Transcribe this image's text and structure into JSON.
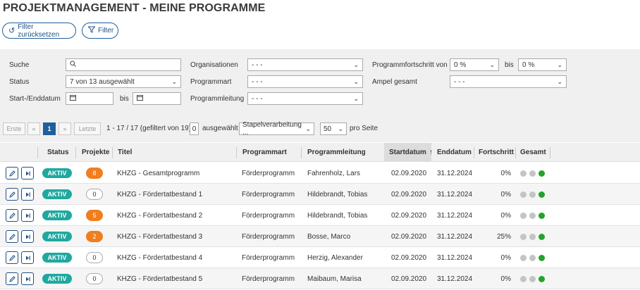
{
  "page": {
    "title": "PROJEKTMANAGEMENT - MEINE PROGRAMME"
  },
  "toolbar": {
    "reset_icon": "undo-icon",
    "reset_label": "Filter zurücksetzen",
    "filter_icon": "funnel-icon",
    "filter_label": "Filter"
  },
  "filters": {
    "search_label": "Suche",
    "search_value": "",
    "status_label": "Status",
    "status_value": "7 von 13 ausgewählt",
    "date_label": "Start-/Enddatum",
    "date_bis": "bis",
    "org_label": "Organisationen",
    "org_value": "- - -",
    "art_label": "Programmart",
    "art_value": "- - -",
    "leitung_label": "Programmleitung",
    "leitung_value": "- - -",
    "fortschritt_label": "Programmfortschritt von",
    "fortschritt_from": "0 %",
    "fortschritt_bis": "bis",
    "fortschritt_to": "0 %",
    "ampel_label": "Ampel gesamt",
    "ampel_value": "- - -"
  },
  "pager": {
    "first": "Erste",
    "prev": "«",
    "current": "1",
    "next": "»",
    "last": "Letzte",
    "range_text": "1 - 17 / 17 (gefiltert von 19)",
    "selected_count": "0",
    "selected_label": "ausgewählt",
    "batch_value": "Stapelverarbeitung ...",
    "per_page_value": "50",
    "per_page_label": "pro Seite"
  },
  "columns": {
    "status": "Status",
    "projekte": "Projekte",
    "titel": "Titel",
    "programmart": "Programmart",
    "programmleitung": "Programmleitung",
    "startdatum": "Startdatum",
    "sort_icon": "↑",
    "enddatum": "Enddatum",
    "fortschritt": "Fortschritt",
    "gesamt": "Gesamt"
  },
  "colors": {
    "aktiv": "#1fa8a0",
    "orange": "#f07d1e",
    "ampel_off": "#c4c4c4",
    "ampel_green": "#22a32a",
    "primary": "#1f5f9e"
  },
  "rows": [
    {
      "status": "AKTIV",
      "projekte": "8",
      "projekte_style": "orange",
      "titel": "KHZG - Gesamtprogramm",
      "programmart": "Förderprogramm",
      "programmleitung": "Fahrenholz, Lars",
      "startdatum": "02.09.2020",
      "enddatum": "31.12.2024",
      "fortschritt": "0%",
      "ampel": [
        "off",
        "off",
        "green"
      ]
    },
    {
      "status": "AKTIV",
      "projekte": "0",
      "projekte_style": "plain",
      "titel": "KHZG - Fördertatbestand 1",
      "programmart": "Förderprogramm",
      "programmleitung": "Hildebrandt, Tobias",
      "startdatum": "02.09.2020",
      "enddatum": "31.12.2024",
      "fortschritt": "0%",
      "ampel": [
        "off",
        "off",
        "green"
      ]
    },
    {
      "status": "AKTIV",
      "projekte": "5",
      "projekte_style": "orange",
      "titel": "KHZG - Fördertatbestand 2",
      "programmart": "Förderprogramm",
      "programmleitung": "Hildebrandt, Tobias",
      "startdatum": "02.09.2020",
      "enddatum": "31.12.2024",
      "fortschritt": "0%",
      "ampel": [
        "off",
        "off",
        "green"
      ]
    },
    {
      "status": "AKTIV",
      "projekte": "2",
      "projekte_style": "orange",
      "titel": "KHZG - Fördertatbestand 3",
      "programmart": "Förderprogramm",
      "programmleitung": "Bosse, Marco",
      "startdatum": "02.09.2020",
      "enddatum": "31.12.2024",
      "fortschritt": "25%",
      "ampel": [
        "off",
        "off",
        "green"
      ]
    },
    {
      "status": "AKTIV",
      "projekte": "0",
      "projekte_style": "plain",
      "titel": "KHZG - Fördertatbestand 4",
      "programmart": "Förderprogramm",
      "programmleitung": "Herzig, Alexander",
      "startdatum": "02.09.2020",
      "enddatum": "31.12.2024",
      "fortschritt": "0%",
      "ampel": [
        "off",
        "off",
        "green"
      ]
    },
    {
      "status": "AKTIV",
      "projekte": "0",
      "projekte_style": "plain",
      "titel": "KHZG - Fördertatbestand 5",
      "programmart": "Förderprogramm",
      "programmleitung": "Maibaum, Marisa",
      "startdatum": "02.09.2020",
      "enddatum": "31.12.2024",
      "fortschritt": "0%",
      "ampel": [
        "off",
        "off",
        "green"
      ]
    }
  ]
}
